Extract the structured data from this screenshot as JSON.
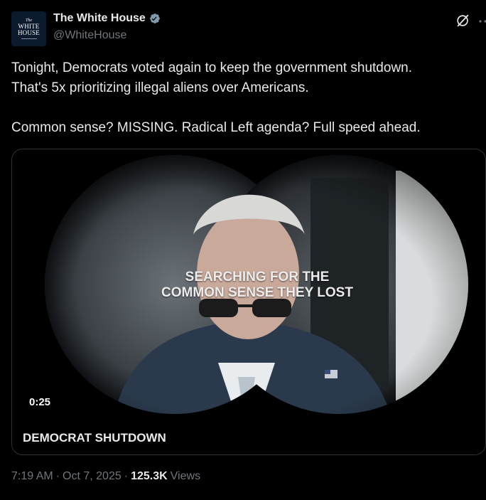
{
  "account": {
    "avatar_lines": [
      "The",
      "WHITE",
      "HOUSE"
    ],
    "display_name": "The White House",
    "handle": "@WhiteHouse",
    "verified_badge_color": "#829aab",
    "avatar_bg": "#0c1a2e"
  },
  "header_icons": {
    "grok": "grok-icon",
    "more": "more-icon"
  },
  "tweet": {
    "text": "Tonight, Democrats voted again to keep the government shutdown.\nThat's 5x prioritizing illegal aliens over Americans.\n\nCommon sense? MISSING. Radical Left agenda? Full speed ahead."
  },
  "media": {
    "overlay_text": "SEARCHING FOR THE\nCOMMON SENSE THEY LOST",
    "timer": "0:25",
    "caption": "DEMOCRAT SHUTDOWN"
  },
  "footer": {
    "time": "7:19 AM",
    "separator1": "·",
    "date": "Oct 7, 2025",
    "separator2": "·",
    "views_count": "125.3K",
    "views_label": "Views"
  },
  "colors": {
    "background": "#000000",
    "text_primary": "#e7e9ea",
    "text_secondary": "#71767b",
    "border": "#2f3336"
  }
}
